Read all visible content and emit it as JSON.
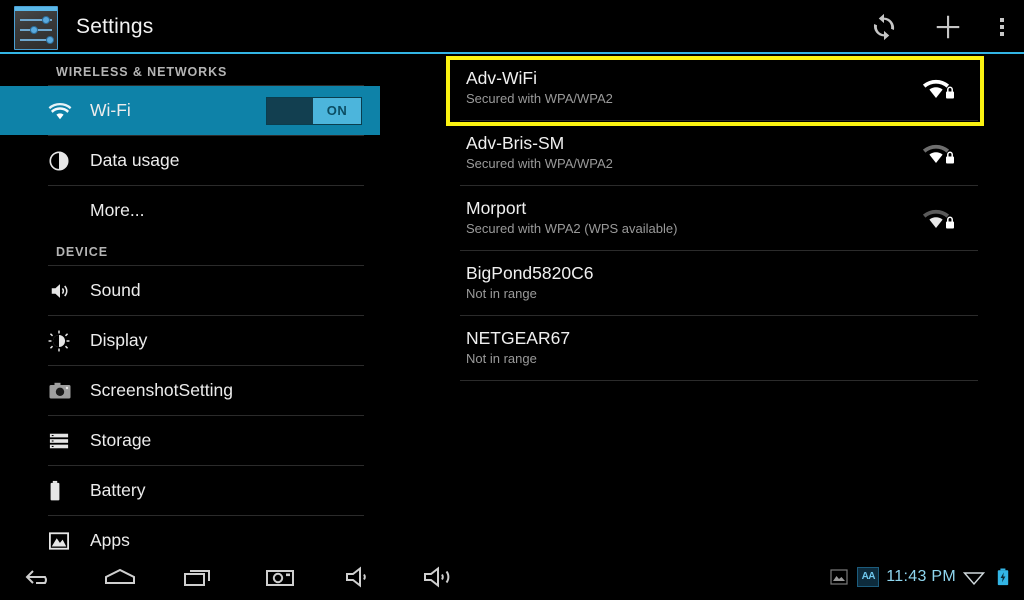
{
  "app": {
    "title": "Settings",
    "icon": "settings-sliders-icon",
    "accent_color": "#33b5e5",
    "selected_row_color": "#0e82a8",
    "highlight_color": "#fbf211"
  },
  "action_bar": {
    "actions": [
      {
        "name": "scan-refresh-icon",
        "label": "Scan"
      },
      {
        "name": "add-network-icon",
        "label": "Add network"
      },
      {
        "name": "overflow-menu-icon",
        "label": "More options"
      }
    ]
  },
  "sidebar": {
    "sections": [
      {
        "header": "WIRELESS & NETWORKS",
        "items": [
          {
            "label": "Wi-Fi",
            "icon": "wifi-icon",
            "selected": true,
            "toggle": {
              "state": "ON",
              "on": true
            }
          },
          {
            "label": "Data usage",
            "icon": "data-usage-icon",
            "selected": false
          },
          {
            "label": "More...",
            "icon": null,
            "selected": false
          }
        ]
      },
      {
        "header": "DEVICE",
        "items": [
          {
            "label": "Sound",
            "icon": "sound-icon",
            "selected": false
          },
          {
            "label": "Display",
            "icon": "display-brightness-icon",
            "selected": false
          },
          {
            "label": "ScreenshotSetting",
            "icon": "camera-icon",
            "selected": false
          },
          {
            "label": "Storage",
            "icon": "storage-icon",
            "selected": false
          },
          {
            "label": "Battery",
            "icon": "battery-icon",
            "selected": false
          },
          {
            "label": "Apps",
            "icon": "apps-icon",
            "selected": false
          }
        ]
      }
    ]
  },
  "wifi_list": {
    "networks": [
      {
        "ssid": "Adv-WiFi",
        "status": "Secured with WPA/WPA2",
        "signal": 4,
        "secured": true,
        "highlighted": true
      },
      {
        "ssid": "Adv-Bris-SM",
        "status": "Secured with WPA/WPA2",
        "signal": 3,
        "secured": true,
        "highlighted": false
      },
      {
        "ssid": "Morport",
        "status": "Secured with WPA2 (WPS available)",
        "signal": 2,
        "secured": true,
        "highlighted": false
      },
      {
        "ssid": "BigPond5820C6",
        "status": "Not in range",
        "signal": 0,
        "secured": false,
        "highlighted": false
      },
      {
        "ssid": "NETGEAR67",
        "status": "Not in range",
        "signal": 0,
        "secured": false,
        "highlighted": false
      }
    ]
  },
  "nav_bar": {
    "buttons": [
      {
        "name": "back-icon",
        "label": "Back"
      },
      {
        "name": "home-icon",
        "label": "Home"
      },
      {
        "name": "recents-icon",
        "label": "Recent apps"
      },
      {
        "name": "screenshot-camera-icon",
        "label": "Screenshot"
      },
      {
        "name": "volume-down-icon",
        "label": "Volume down"
      },
      {
        "name": "volume-up-icon",
        "label": "Volume up"
      }
    ],
    "status": {
      "screenshot_indicator": "screenshot-saved-icon",
      "aa_indicator": "AA",
      "clock": "11:43 PM",
      "wifi_indicator": "wifi-signal-icon",
      "battery_indicator": "battery-charging-icon"
    }
  }
}
